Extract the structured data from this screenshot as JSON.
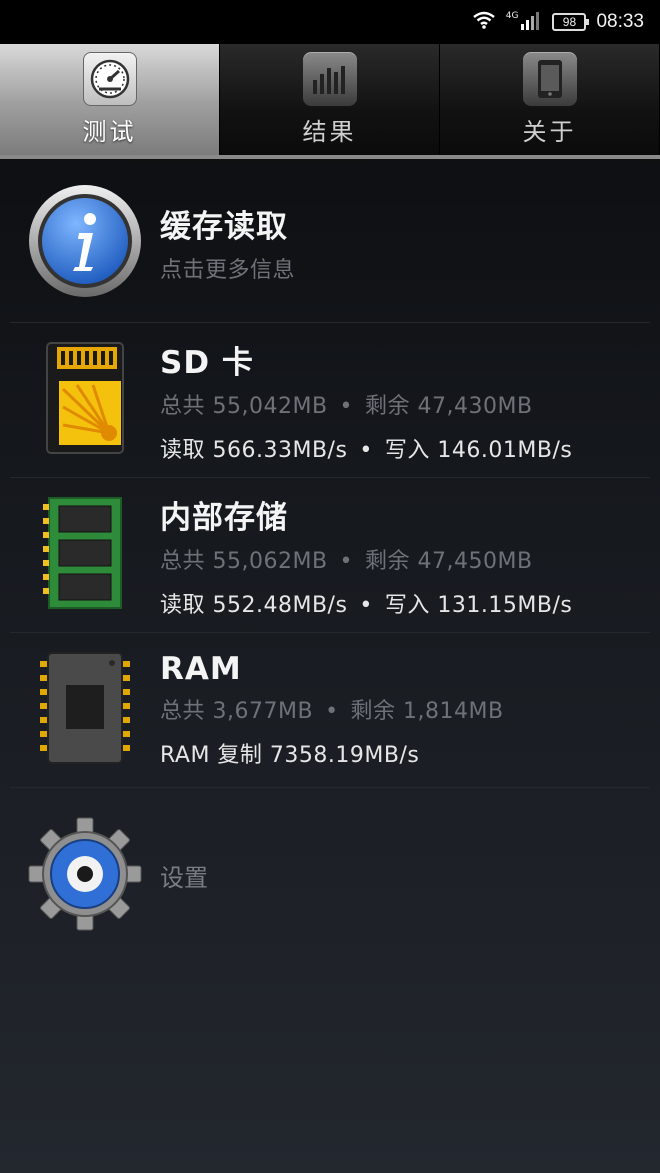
{
  "status": {
    "network": "4G",
    "battery": "98",
    "time": "08:33"
  },
  "tabs": [
    {
      "label": "测试",
      "icon": "speedometer-icon",
      "active": true
    },
    {
      "label": "结果",
      "icon": "bar-chart-icon",
      "active": false
    },
    {
      "label": "关于",
      "icon": "phone-icon",
      "active": false
    }
  ],
  "cache": {
    "title": "缓存读取",
    "subtitle": "点击更多信息"
  },
  "sd": {
    "title": "SD 卡",
    "total": "总共 55,042MB",
    "free": "剩余 47,430MB",
    "read": "读取 566.33MB/s",
    "write": "写入 146.01MB/s"
  },
  "internal": {
    "title": "内部存储",
    "total": "总共 55,062MB",
    "free": "剩余 47,450MB",
    "read": "读取 552.48MB/s",
    "write": "写入 131.15MB/s"
  },
  "ram": {
    "title": "RAM",
    "total": "总共 3,677MB",
    "free": "剩余 1,814MB",
    "copy": "RAM 复制 7358.19MB/s"
  },
  "settings": {
    "label": "设置"
  },
  "separator": "•",
  "colors": {
    "accent_blue": "#2f6fd6",
    "sd_yellow": "#f4c20d",
    "board_green": "#2e8b3a"
  }
}
